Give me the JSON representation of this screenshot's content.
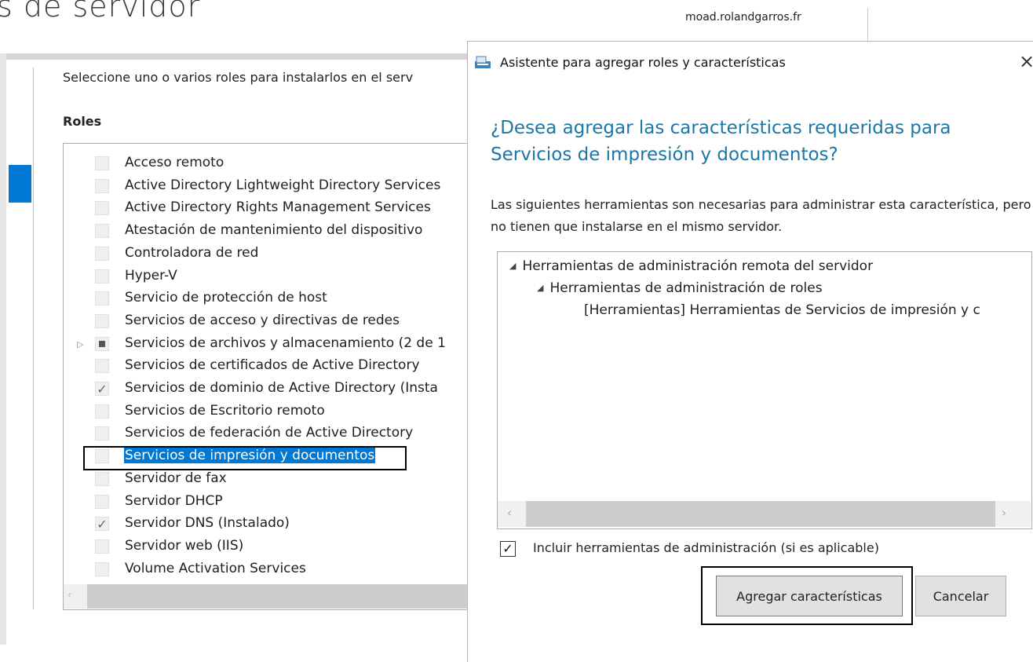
{
  "background_wizard": {
    "title_fragment": "s de servidor",
    "server_name": "moad.rolandgarros.fr",
    "instruction": "Seleccione uno o varios roles para instalarlos en el serv",
    "roles_heading": "Roles",
    "roles": [
      {
        "label": "Acceso remoto",
        "state": "unchecked"
      },
      {
        "label": "Active Directory Lightweight Directory Services",
        "state": "unchecked"
      },
      {
        "label": "Active Directory Rights Management Services",
        "state": "unchecked"
      },
      {
        "label": "Atestación de mantenimiento del dispositivo",
        "state": "unchecked"
      },
      {
        "label": "Controladora de red",
        "state": "unchecked"
      },
      {
        "label": "Hyper-V",
        "state": "unchecked"
      },
      {
        "label": "Servicio de protección de host",
        "state": "unchecked"
      },
      {
        "label": "Servicios de acceso y directivas de redes",
        "state": "unchecked"
      },
      {
        "label": "Servicios de archivos y almacenamiento (2 de 1",
        "state": "partial",
        "expandable": true
      },
      {
        "label": "Servicios de certificados de Active Directory",
        "state": "unchecked"
      },
      {
        "label": "Servicios de dominio de Active Directory (Insta",
        "state": "checked"
      },
      {
        "label": "Servicios de Escritorio remoto",
        "state": "unchecked"
      },
      {
        "label": "Servicios de federación de Active Directory",
        "state": "unchecked"
      },
      {
        "label": "Servicios de impresión y documentos",
        "state": "unchecked",
        "selected": true
      },
      {
        "label": "Servidor de fax",
        "state": "unchecked"
      },
      {
        "label": "Servidor DHCP",
        "state": "unchecked"
      },
      {
        "label": "Servidor DNS (Instalado)",
        "state": "checked"
      },
      {
        "label": "Servidor web (IIS)",
        "state": "unchecked"
      },
      {
        "label": "Volume Activation Services",
        "state": "unchecked"
      }
    ]
  },
  "dialog": {
    "title": "Asistente para agregar roles y características",
    "close_glyph": "×",
    "heading": "¿Desea agregar las características requeridas para Servicios de impresión y documentos?",
    "description": "Las siguientes herramientas son necesarias para administrar esta característica, pero no tienen que instalarse en el mismo servidor.",
    "tree": [
      {
        "label": "Herramientas de administración remota del servidor",
        "level": 0,
        "expanded": true
      },
      {
        "label": "Herramientas de administración de roles",
        "level": 1,
        "expanded": true
      },
      {
        "label": "[Herramientas] Herramientas de Servicios de impresión y c",
        "level": 2
      }
    ],
    "include_tools": {
      "label": "Incluir herramientas de administración (si es aplicable)",
      "checked": true
    },
    "buttons": {
      "add": "Agregar características",
      "cancel": "Cancelar"
    }
  },
  "icons": {
    "check": "✓",
    "expander": "▷",
    "expanded": "◢",
    "scroll_left": "‹",
    "scroll_right": "›"
  },
  "colors": {
    "accent": "#0078d4",
    "heading": "#1a77a6"
  }
}
